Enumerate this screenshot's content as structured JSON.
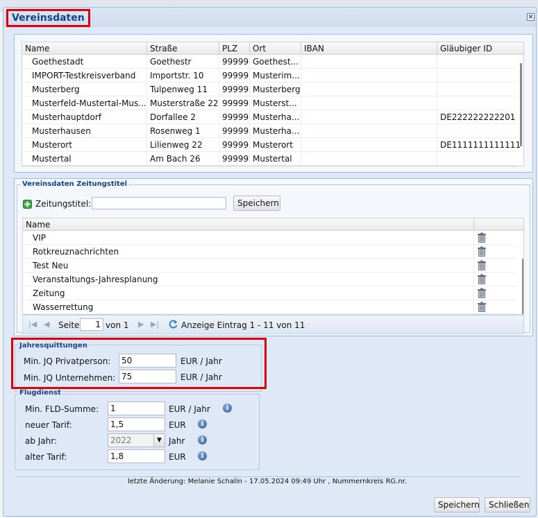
{
  "window": {
    "title": "Vereinsdaten",
    "close_glyph": "×"
  },
  "vereine_grid": {
    "columns": [
      "Name",
      "Straße",
      "PLZ",
      "Ort",
      "IBAN",
      "Gläubiger ID"
    ],
    "rows": [
      [
        "Goethestadt",
        "Goethestr",
        "99999",
        "Goethest...",
        "",
        ""
      ],
      [
        "IMPORT-Testkreisverband",
        "Importstr. 10",
        "99999",
        "Musterim...",
        "",
        ""
      ],
      [
        "Musterberg",
        "Tulpenweg 11",
        "99999",
        "Musterberg",
        "",
        ""
      ],
      [
        "Musterfeld-Mustertal-Mus...",
        "Musterstraße 22",
        "99999",
        "Musterst...",
        "",
        ""
      ],
      [
        "Musterhauptdorf",
        "Dorfallee 2",
        "99999",
        "Musterha...",
        "",
        "DE222222222201"
      ],
      [
        "Musterhausen",
        "Rosenweg 1",
        "99999",
        "Musterha...",
        "",
        ""
      ],
      [
        "Musterort",
        "Lilienweg 22",
        "99999",
        "Musterort",
        "",
        "DE1111111111111"
      ],
      [
        "Mustertal",
        "Am Bach 26",
        "99999",
        "Mustertal",
        "",
        ""
      ]
    ]
  },
  "zeitung": {
    "legend": "Vereinsdaten Zeitungstitel",
    "field_label": "Zeitungstitel:",
    "field_value": "",
    "save_label": "Speichern",
    "column": "Name",
    "rows": [
      "VIP",
      "Rotkreuznachrichten",
      "Test Neu",
      "Veranstaltungs-Jahresplanung",
      "Zeitung",
      "Wasserrettung"
    ],
    "paging": {
      "page_label": "Seite",
      "page_value": "1",
      "of_label": "von 1",
      "display_text": "Anzeige Eintrag 1 - 11 von 11"
    }
  },
  "jahresquittungen": {
    "legend": "Jahresquittungen",
    "rows": [
      {
        "label": "Min. JQ Privatperson:",
        "value": "50",
        "unit": "EUR / Jahr"
      },
      {
        "label": "Min. JQ Unternehmen:",
        "value": "75",
        "unit": "EUR / Jahr"
      }
    ]
  },
  "flugdienst": {
    "legend": "Flugdienst",
    "rows": [
      {
        "label": "Min. FLD-Summe:",
        "value": "1",
        "unit": "EUR / Jahr"
      },
      {
        "label": "neuer Tarif:",
        "value": "1,5",
        "unit": "EUR"
      },
      {
        "label": "ab Jahr:",
        "value": "2022",
        "unit": "Jahr"
      },
      {
        "label": "alter Tarif:",
        "value": "1,8",
        "unit": "EUR"
      }
    ]
  },
  "footer": {
    "last_change": "letzte Änderung: Melanie Schalin - 17.05.2024 09:49 Uhr , Nummernkreis RG.nr.",
    "save_label": "Speichern",
    "close_label": "Schließen"
  },
  "colors": {
    "highlight": "#e00000",
    "title": "#15428b",
    "legend": "#15428b"
  }
}
